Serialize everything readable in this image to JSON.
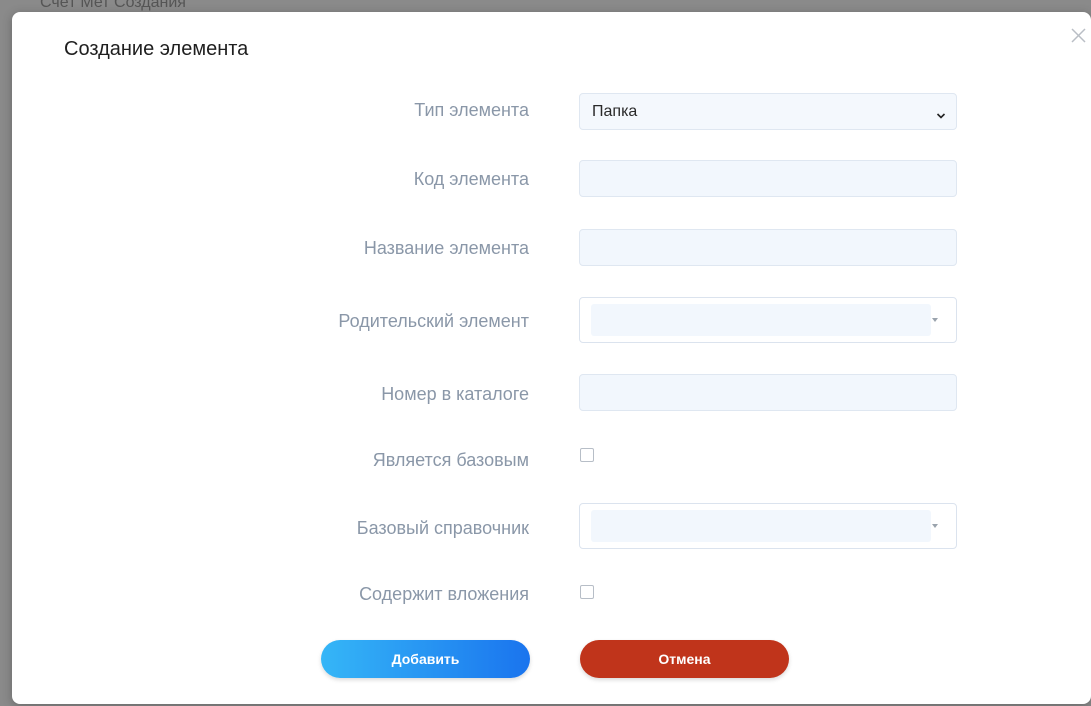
{
  "background": {
    "partial_text": "Счёт Мет Создания"
  },
  "modal": {
    "title": "Создание элемента",
    "close_icon": "close-icon",
    "fields": {
      "element_type": {
        "label": "Тип элемента",
        "value": "Папка"
      },
      "element_code": {
        "label": "Код элемента",
        "value": ""
      },
      "element_name": {
        "label": "Название элемента",
        "value": ""
      },
      "parent_element": {
        "label": "Родительский элемент",
        "value": ""
      },
      "catalog_number": {
        "label": "Номер в каталоге",
        "value": ""
      },
      "is_base": {
        "label": "Является базовым",
        "checked": false
      },
      "base_reference": {
        "label": "Базовый справочник",
        "value": ""
      },
      "contains_attachments": {
        "label": "Содержит вложения",
        "checked": false
      }
    },
    "buttons": {
      "add": "Добавить",
      "cancel": "Отмена"
    }
  },
  "colors": {
    "overlay": "#8a8a8a",
    "label": "#8a97a8",
    "input_bg": "#f2f7fd",
    "add_gradient_start": "#35b6f7",
    "add_gradient_end": "#1a74ee",
    "cancel": "#c0341b"
  }
}
